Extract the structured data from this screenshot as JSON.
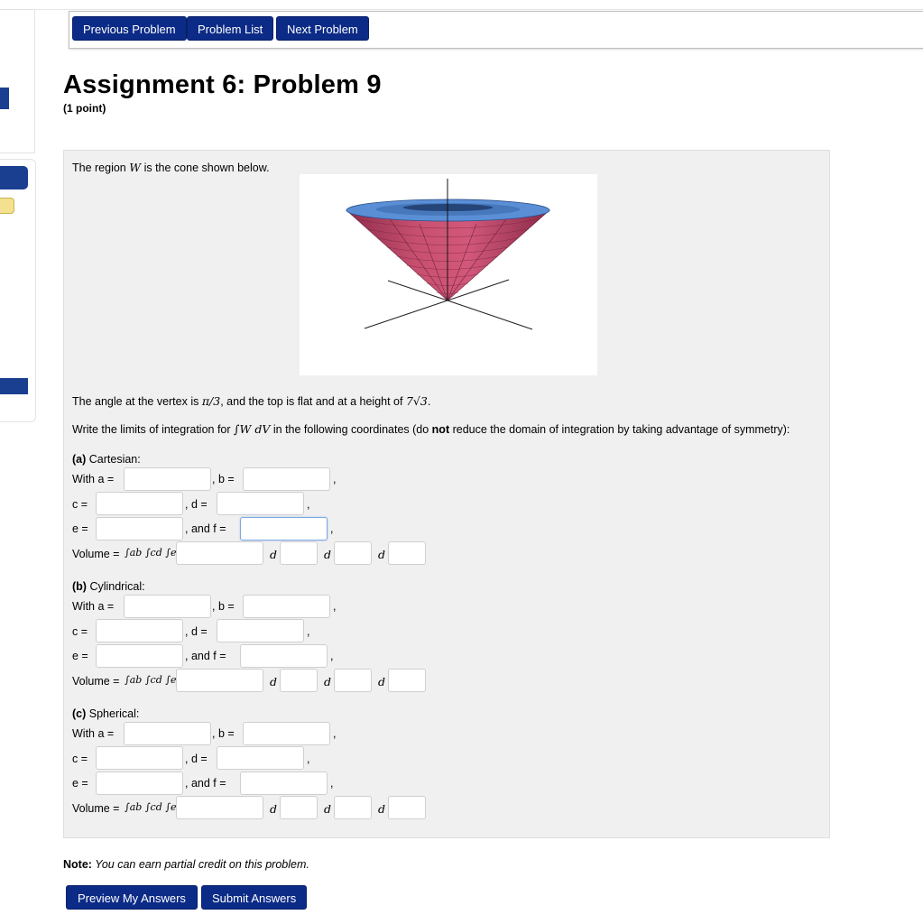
{
  "nav": {
    "previous": "Previous Problem",
    "list": "Problem List",
    "next": "Next Problem"
  },
  "title": "Assignment 6: Problem 9",
  "points": "(1 point)",
  "problem": {
    "intro_prefix": "The region ",
    "intro_var": "W",
    "intro_suffix": " is the cone shown below.",
    "angle_text_1": "The angle at the vertex is ",
    "angle_math": "π/3",
    "angle_text_2": ", and the top is flat and at a height of ",
    "height_math": "7√3",
    "angle_text_3": ".",
    "limits_prefix": "Write the limits of integration for ",
    "limits_math": "∫W dV",
    "limits_mid": " in the following coordinates (do ",
    "limits_bold": "not",
    "limits_suffix": " reduce the domain of integration by taking advantage of symmetry):",
    "sections": [
      {
        "tag": "(a)",
        "name": " Cartesian:"
      },
      {
        "tag": "(b)",
        "name": " Cylindrical:"
      },
      {
        "tag": "(c)",
        "name": " Spherical:"
      }
    ],
    "labels": {
      "with_a": "With a =",
      "b": ", b =",
      "comma": ",",
      "c": "c =",
      "d": ", d =",
      "e": "e =",
      "and_f": ", and f =",
      "volume": "Volume =",
      "d_symbol": "d"
    },
    "integral_label": "∫ab ∫cd ∫ef"
  },
  "note": {
    "label": "Note:",
    "text": " You can earn partial credit on this problem."
  },
  "buttons": {
    "preview": "Preview My Answers",
    "submit": "Submit Answers"
  },
  "colors": {
    "button_bg": "#0b2b86",
    "cone_side": "#c0476c",
    "cone_top": "#5a8fd6",
    "panel_bg": "#f0f0f0"
  }
}
